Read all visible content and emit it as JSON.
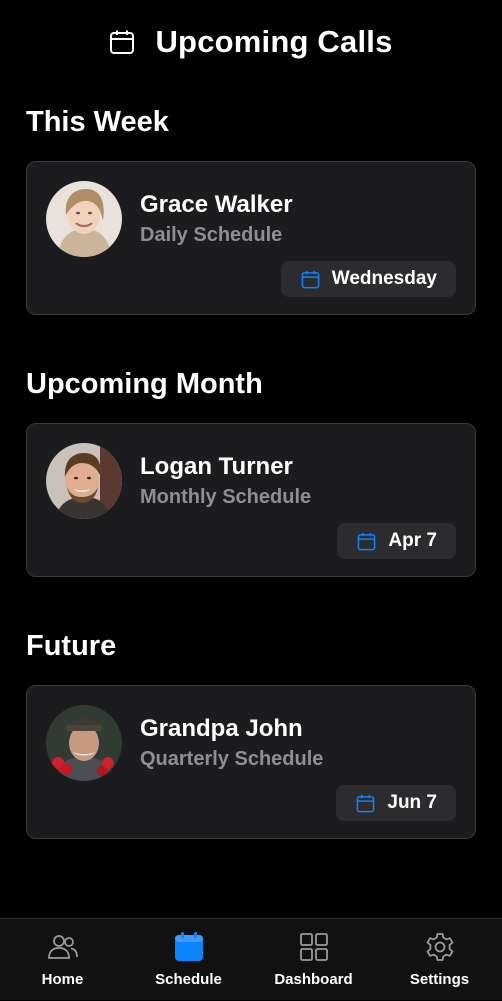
{
  "header": {
    "title": "Upcoming Calls",
    "icon": "calendar-icon"
  },
  "sections": [
    {
      "title": "This Week",
      "card": {
        "name": "Grace Walker",
        "schedule": "Daily Schedule",
        "date": "Wednesday",
        "date_icon": "calendar-icon"
      }
    },
    {
      "title": "Upcoming Month",
      "card": {
        "name": "Logan Turner",
        "schedule": "Monthly Schedule",
        "date": "Apr 7",
        "date_icon": "calendar-icon"
      }
    },
    {
      "title": "Future",
      "card": {
        "name": "Grandpa John",
        "schedule": "Quarterly Schedule",
        "date": "Jun 7",
        "date_icon": "calendar-icon"
      }
    }
  ],
  "tabbar": {
    "items": [
      {
        "label": "Home",
        "icon": "people-icon",
        "active": false
      },
      {
        "label": "Schedule",
        "icon": "calendar-icon",
        "active": true
      },
      {
        "label": "Dashboard",
        "icon": "grid-icon",
        "active": false
      },
      {
        "label": "Settings",
        "icon": "gear-icon",
        "active": false
      }
    ]
  },
  "colors": {
    "background": "#000000",
    "card": "#1c1c1e",
    "card_border": "#3a3a3c",
    "pill": "#2c2c2e",
    "secondary_text": "#8e8e93",
    "accent": "#0a84ff",
    "icon_inactive": "#9a9a9e"
  }
}
